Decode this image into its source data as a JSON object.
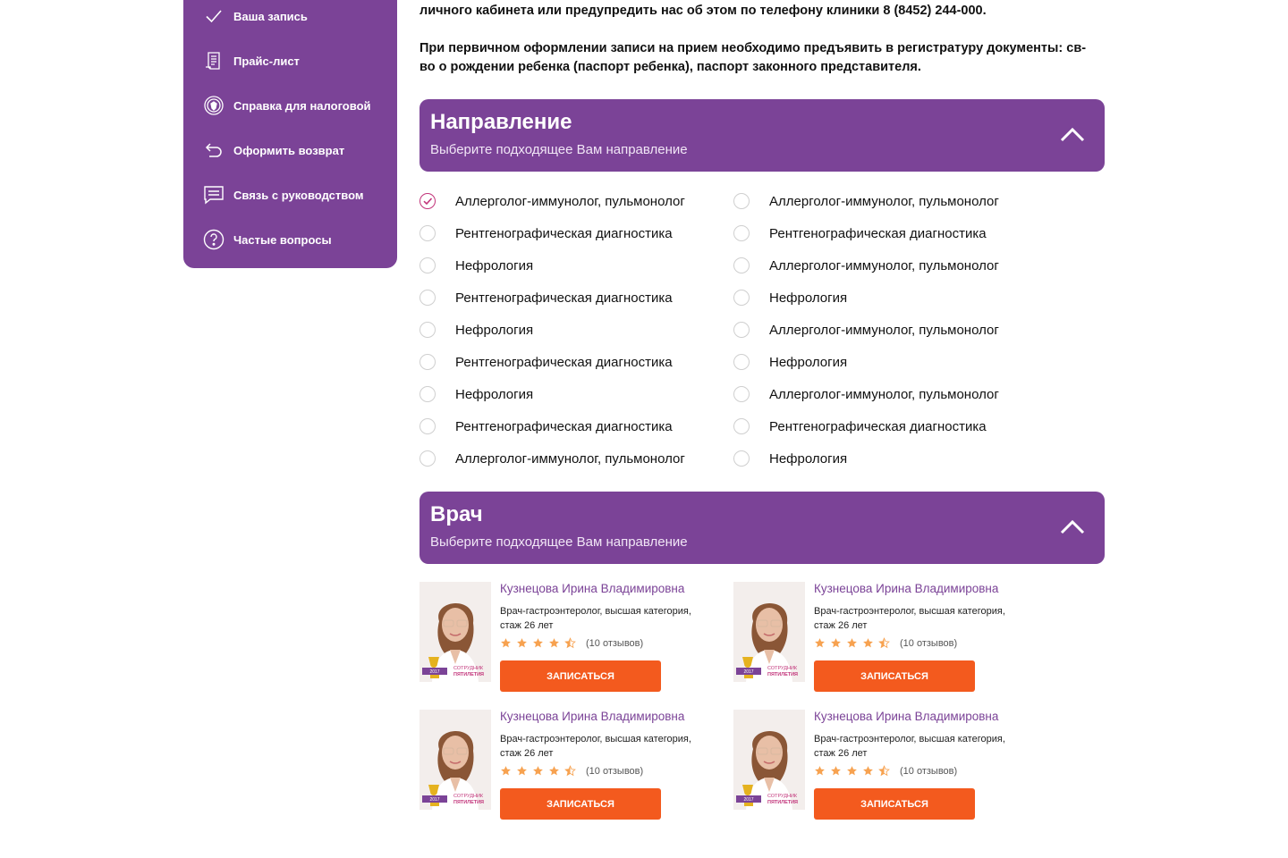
{
  "colors": {
    "brand": "#7b4397",
    "accent": "#f35a1e",
    "check": "#c2347a",
    "star": "#f7a250"
  },
  "sidebar": {
    "items": [
      {
        "label": "Ваша запись",
        "icon": "check-icon"
      },
      {
        "label": "Прайс-лист",
        "icon": "price-list-icon"
      },
      {
        "label": "Справка для налоговой",
        "icon": "tax-emblem-icon"
      },
      {
        "label": "Оформить возврат",
        "icon": "return-arrow-icon"
      },
      {
        "label": "Связь с руководством",
        "icon": "message-icon"
      },
      {
        "label": "Частые вопросы",
        "icon": "question-icon"
      }
    ]
  },
  "intro": {
    "line1": "личного кабинета или предупредить нас об этом по телефону клиники 8 (8452) 244-000.",
    "line2": "При первичном оформлении записи на прием необходимо предъявить в регистратуру документы: св-во о рождении ребенка (паспорт ребенка), паспорт законного представителя."
  },
  "direction": {
    "title": "Направление",
    "subtitle": "Выберите подходящее Вам направление",
    "options": [
      {
        "label": "Аллерголог-иммунолог, пульмонолог",
        "checked": true
      },
      {
        "label": "Аллерголог-иммунолог, пульмонолог",
        "checked": false
      },
      {
        "label": "Рентгенографическая диагностика",
        "checked": false
      },
      {
        "label": "Рентгенографическая диагностика",
        "checked": false
      },
      {
        "label": "Нефрология",
        "checked": false
      },
      {
        "label": "Аллерголог-иммунолог, пульмонолог",
        "checked": false
      },
      {
        "label": "Рентгенографическая диагностика",
        "checked": false
      },
      {
        "label": "Нефрология",
        "checked": false
      },
      {
        "label": "Нефрология",
        "checked": false
      },
      {
        "label": "Аллерголог-иммунолог, пульмонолог",
        "checked": false
      },
      {
        "label": "Рентгенографическая диагностика",
        "checked": false
      },
      {
        "label": "Нефрология",
        "checked": false
      },
      {
        "label": "Нефрология",
        "checked": false
      },
      {
        "label": "Аллерголог-иммунолог, пульмонолог",
        "checked": false
      },
      {
        "label": "Рентгенографическая диагностика",
        "checked": false
      },
      {
        "label": "Рентгенографическая диагностика",
        "checked": false
      },
      {
        "label": "Аллерголог-иммунолог, пульмонолог",
        "checked": false
      },
      {
        "label": "Нефрология",
        "checked": false
      }
    ]
  },
  "doctor": {
    "title": "Врач",
    "subtitle": "Выберите подходящее Вам направление",
    "cards": [
      {
        "name": "Кузнецова Ирина Владимировна",
        "spec": "Врач-гастроэнтеролог, высшая категория, стаж 26 лет",
        "rating": 4.5,
        "reviews": "(10 отзывов)",
        "button": "ЗАПИСАТЬСЯ",
        "badge_year": "2017",
        "badge_line1": "СОТРУДНИК",
        "badge_line2": "ПЯТИЛЕТИЯ"
      },
      {
        "name": "Кузнецова Ирина Владимировна",
        "spec": "Врач-гастроэнтеролог, высшая категория, стаж 26 лет",
        "rating": 4.5,
        "reviews": "(10 отзывов)",
        "button": "ЗАПИСАТЬСЯ",
        "badge_year": "2017",
        "badge_line1": "СОТРУДНИК",
        "badge_line2": "ПЯТИЛЕТИЯ"
      },
      {
        "name": "Кузнецова Ирина Владимировна",
        "spec": "Врач-гастроэнтеролог, высшая категория, стаж 26 лет",
        "rating": 4.5,
        "reviews": "(10 отзывов)",
        "button": "ЗАПИСАТЬСЯ",
        "badge_year": "2017",
        "badge_line1": "СОТРУДНИК",
        "badge_line2": "ПЯТИЛЕТИЯ"
      },
      {
        "name": "Кузнецова Ирина Владимировна",
        "spec": "Врач-гастроэнтеролог, высшая категория, стаж 26 лет",
        "rating": 4.5,
        "reviews": "(10 отзывов)",
        "button": "ЗАПИСАТЬСЯ",
        "badge_year": "2017",
        "badge_line1": "СОТРУДНИК",
        "badge_line2": "ПЯТИЛЕТИЯ"
      }
    ]
  }
}
